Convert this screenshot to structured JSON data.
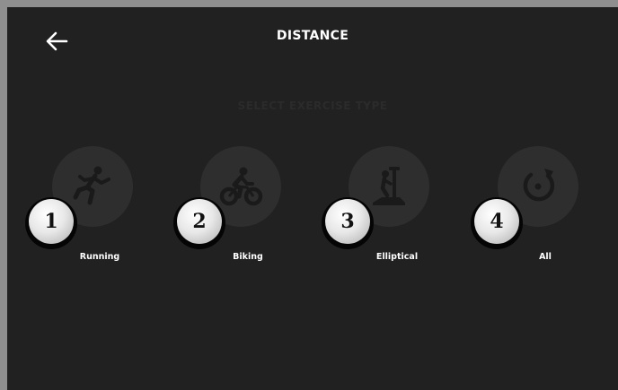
{
  "header": {
    "title": "DISTANCE",
    "back_icon": "arrow-left-icon"
  },
  "subtitle": "SELECT EXERCISE TYPE",
  "options": [
    {
      "label": "Running",
      "badge": "1",
      "icon": "runner-icon"
    },
    {
      "label": "Biking",
      "badge": "2",
      "icon": "cyclist-icon"
    },
    {
      "label": "Elliptical",
      "badge": "3",
      "icon": "elliptical-icon"
    },
    {
      "label": "All",
      "badge": "4",
      "icon": "refresh-icon"
    }
  ],
  "colors": {
    "screen_bg": "#212121",
    "frame": "#8f8f8f",
    "icon_circle": "#2e2e2e",
    "icon_fill": "#1a1a1a",
    "text": "#ffffff"
  }
}
